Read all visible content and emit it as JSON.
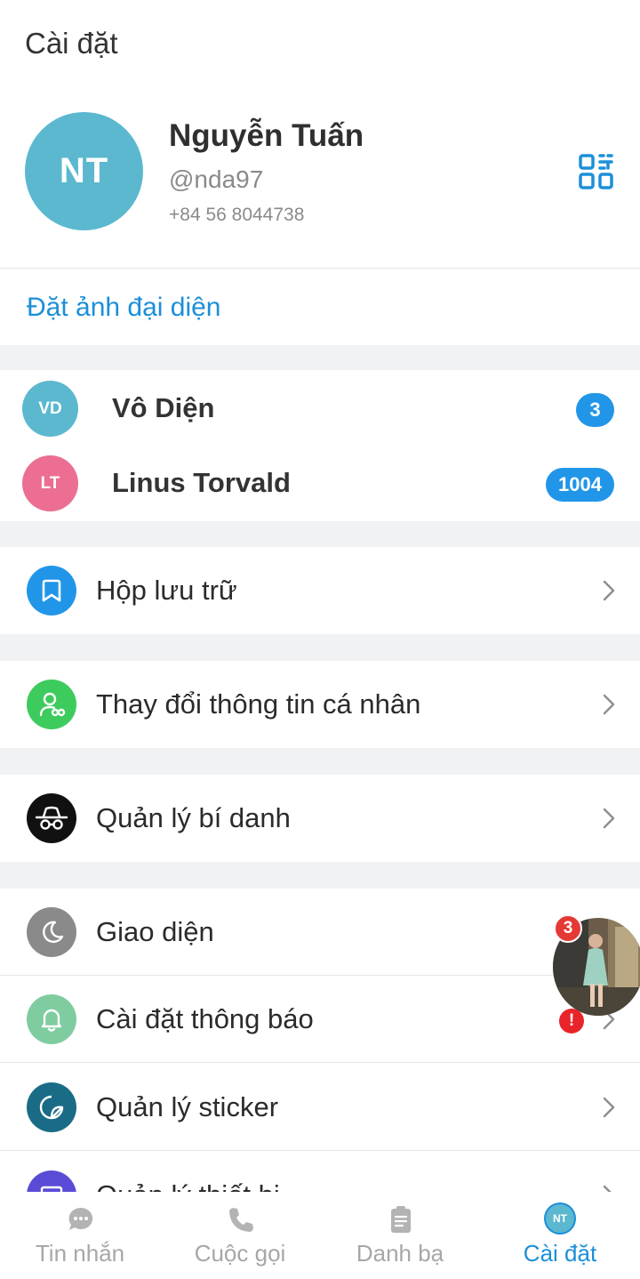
{
  "header": {
    "title": "Cài đặt"
  },
  "profile": {
    "avatar_initials": "NT",
    "name": "Nguyễn Tuấn",
    "username": "@nda97",
    "phone": "+84 56 8044738",
    "qr_icon": "qr-code-icon"
  },
  "set_avatar": {
    "label": "Đặt ảnh đại diện"
  },
  "accounts": [
    {
      "initials": "VD",
      "name": "Vô Diện",
      "badge": "3",
      "color": "#5bb8cf"
    },
    {
      "initials": "LT",
      "name": "Linus Torvald",
      "badge": "1004",
      "color": "#ec6e92"
    }
  ],
  "menu": {
    "archive": {
      "label": "Hộp lưu trữ",
      "icon": "bookmark-icon",
      "color": "#2196e8"
    },
    "profile_edit": {
      "label": "Thay đổi thông tin cá nhân",
      "icon": "user-edit-icon",
      "color": "#3ecb5e"
    },
    "alias": {
      "label": "Quản lý bí danh",
      "icon": "incognito-icon",
      "color": "#111111"
    },
    "appearance": {
      "label": "Giao diện",
      "icon": "moon-icon",
      "color": "#8a8a8a"
    },
    "notifications": {
      "label": "Cài đặt thông báo",
      "icon": "bell-icon",
      "color": "#7fcca0"
    },
    "stickers": {
      "label": "Quản lý sticker",
      "icon": "sticker-icon",
      "color": "#1a6c86"
    },
    "devices": {
      "label": "Quản lý thiết bị",
      "icon": "device-icon",
      "color": "#5a4bd6"
    }
  },
  "floating_bubble": {
    "badge": "3",
    "alert": "!"
  },
  "tabbar": [
    {
      "label": "Tin nhắn",
      "icon": "chat-icon"
    },
    {
      "label": "Cuộc gọi",
      "icon": "phone-icon"
    },
    {
      "label": "Danh bạ",
      "icon": "contacts-icon"
    },
    {
      "label": "Cài đặt",
      "icon": "avatar",
      "avatar_initials": "NT"
    }
  ],
  "colors": {
    "accent": "#1b8fd9",
    "badge_blue": "#2196e8",
    "badge_red": "#e53935",
    "gap": "#f1f2f4"
  }
}
